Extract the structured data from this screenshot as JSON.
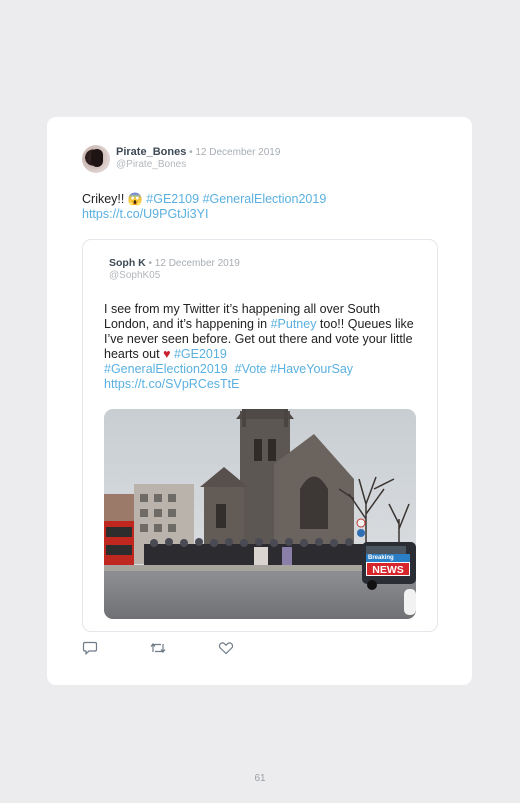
{
  "tweet": {
    "author_name": "Pirate_Bones",
    "date": " • 12 December 2019",
    "handle": "@Pirate_Bones",
    "text_plain": "Crikey!! ",
    "emoji": "😱",
    "hashtag1": " #GE2109",
    "hashtag2": " #GeneralElection2019",
    "link": "https://t.co/U9PGtJi3YI"
  },
  "quoted_tweet": {
    "author_name": "Soph K",
    "date": " • 12 December 2019",
    "handle": "@SophK05",
    "text_part1": "I see from my Twitter it’s happening all over South London, and it’s happening in ",
    "putney": "#Putney",
    "text_part2": " too!! Queues like I’ve never seen before. Get out there and vote your little hearts out ",
    "heart": "♥",
    "hashtag_ge2019": " #GE2019",
    "hashtag_ge": "#GeneralElection2019",
    "hashtag_vote": "#Vote",
    "hashtag_haveyoursay": "#HaveYourSay",
    "link": "https://t.co/SVpRCesTtE",
    "news_badge_top": "Breaking",
    "news_badge": "NEWS"
  },
  "actions": {
    "reply_icon": "reply-icon",
    "retweet_icon": "retweet-icon",
    "like_icon": "heart-icon"
  },
  "page_number": "61",
  "colors": {
    "link": "#5ab0e0",
    "background": "#ececee",
    "card": "#ffffff"
  }
}
